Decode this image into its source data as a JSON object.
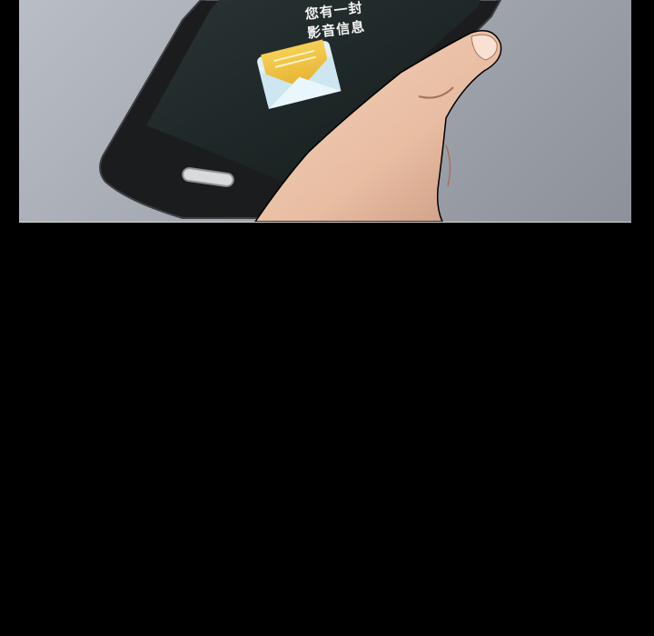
{
  "phone": {
    "notification_line1": "您有一封",
    "notification_line2": "影音信息",
    "screen_color": "#1e2728",
    "envelope_color": "#f0c040"
  }
}
